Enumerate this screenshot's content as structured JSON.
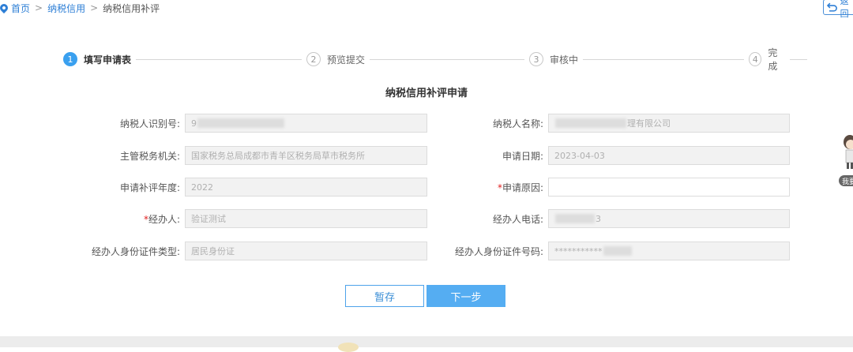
{
  "breadcrumb": {
    "home": "首页",
    "parent": "纳税信用",
    "current": "纳税信用补评",
    "separator": ">"
  },
  "back_button": {
    "label": "返回",
    "icon": "back-arrow-icon"
  },
  "steps": [
    {
      "number": "1",
      "label": "填写申请表",
      "state": "active"
    },
    {
      "number": "2",
      "label": "预览提交",
      "state": "inactive"
    },
    {
      "number": "3",
      "label": "审核中",
      "state": "inactive"
    },
    {
      "number": "4",
      "label": "完成",
      "state": "inactive"
    }
  ],
  "form": {
    "title": "纳税信用补评申请",
    "fields": {
      "taxpayer_id": {
        "label": "纳税人识别号:",
        "value": "9"
      },
      "taxpayer_name": {
        "label": "纳税人名称:",
        "value": "理有限公司"
      },
      "tax_authority": {
        "label": "主管税务机关:",
        "value": "国家税务总局成都市青羊区税务局草市税务所"
      },
      "apply_date": {
        "label": "申请日期:",
        "value": "2023-04-03"
      },
      "rating_year": {
        "label": "申请补评年度:",
        "value": "2022"
      },
      "reason": {
        "label": "申请原因:",
        "value": "",
        "required_mark": "*"
      },
      "handler": {
        "label": "经办人:",
        "value": "验证测试",
        "required_mark": "*"
      },
      "handler_phone": {
        "label": "经办人电话:",
        "value": "3"
      },
      "id_type": {
        "label": "经办人身份证件类型:",
        "value": "居民身份证"
      },
      "id_number": {
        "label": "经办人身份证件号码:",
        "value": "***********"
      }
    }
  },
  "buttons": {
    "save": "暂存",
    "next": "下一步"
  },
  "mascot": {
    "label": "我要"
  },
  "colors": {
    "accent": "#3aa0ef",
    "link": "#2e7fd6",
    "required": "#e02020"
  }
}
